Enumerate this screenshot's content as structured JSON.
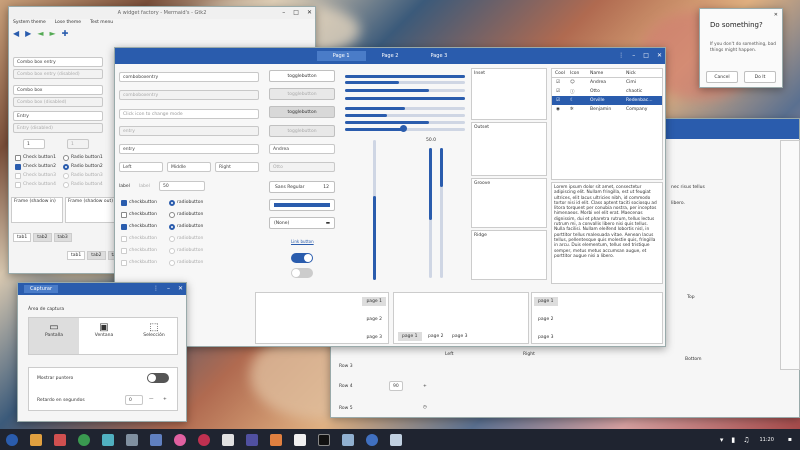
{
  "colors": {
    "accent": "#2a5cad",
    "taskbar": "#1f2430"
  },
  "main_window": {
    "title": "A widget factory - Mermaid's - Gtk2",
    "menus": [
      "System theme",
      "Lose theme",
      "Test menu"
    ]
  },
  "left_panel": {
    "combo1": "Combo box entry",
    "combo1b": "Combo box entry (disabled)",
    "combo2": "Combo box",
    "combo2b": "Combo box (disabled)",
    "entry": "Entry",
    "entry_dis": "Entry (disabled)",
    "spin1": "1",
    "spin2": "1",
    "checks": [
      "Check button1",
      "Check button2",
      "Check button3",
      "Check button4"
    ],
    "radios": [
      "Radio button1",
      "Radio button2",
      "Radio button3",
      "Radio button4"
    ],
    "frame1": "Frame (shadow in)",
    "frame2": "Frame (shadow out)",
    "tabs": [
      "tab1",
      "tab2",
      "tab3"
    ],
    "tabs2": [
      "tab1",
      "tab2",
      "tab3"
    ]
  },
  "dialog": {
    "title": "Do something?",
    "body": "If you don't do something, bad things might happen.",
    "cancel": "Cancel",
    "ok": "Do It"
  },
  "gtk3": {
    "tabs": [
      "Page 1",
      "Page 2",
      "Page 3"
    ],
    "combo": "comboboxentry",
    "combo_dis": "comboboxentry",
    "entry_click": "Click icon to change mode",
    "entry_dis": "entry",
    "entry": "entry",
    "align": [
      "Left",
      "Middle",
      "Right"
    ],
    "label": "label",
    "label2": "label",
    "spin": "50",
    "checks": [
      "checkbutton",
      "checkbutton",
      "checkbutton",
      "checkbutton",
      "checkbutton",
      "checkbutton"
    ],
    "radios": [
      "radiobutton",
      "radiobutton",
      "radiobutton",
      "radiobutton",
      "radiobutton",
      "radiobutton"
    ],
    "toggles": [
      "togglebutton",
      "togglebutton",
      "togglebutton",
      "togglebutton"
    ],
    "combo_andrea": "Andrea",
    "combo_otto": "Otto",
    "font": "Sans Regular",
    "font_size": "12",
    "none": "(None)",
    "link": "Link button",
    "scale_value": "50.0",
    "frames": [
      "Inset",
      "Outset",
      "Groove",
      "Ridge"
    ],
    "tree_headers": [
      "Cool",
      "Icon",
      "Name",
      "Nick"
    ],
    "tree_rows": [
      [
        "Andrea",
        "Cimi"
      ],
      [
        "Otto",
        "chaotic"
      ],
      [
        "Orville",
        "Redenbac..."
      ],
      [
        "Benjamin",
        "Company"
      ]
    ],
    "text": "Lorem ipsum dolor sit amet, consectetur adipiscing elit. Nullam fringilla, est ut feugiat ultrices, elit lacus ultricies nibh, id commodo tortor nisi id elit. Class aptent taciti sociosqu ad litora torquent per conubia nostra, per inceptos himenaeos. Morbi vel elit erat. Maecenas dignissim, dui et pharetra rutrum, tellus lectus rutrum mi, a convallis libero nisi quis tellus. Nulla facilisi. Nullam eleifend lobortis nisl, in porttitor tellus malesuada vitae. Aenean lacus tellus, pellentesque quis molestie quis, fringilla in arcu. Duis elementum, tellus sed tristique semper, metus metus accumsan augue, et porttitor augue nisi a libero.",
    "pages": [
      "page 1",
      "page 2",
      "page 3"
    ]
  },
  "capture": {
    "title": "Capturar",
    "area_label": "Área de captura",
    "options": [
      "Pantalla",
      "Ventana",
      "Selección"
    ],
    "pointer": "Mostrar puntero",
    "delay": "Retardo en segundos",
    "delay_value": "0"
  },
  "back_window": {
    "rows": [
      "Row 3",
      "Row 4",
      "Row 5"
    ],
    "row4_val": "90",
    "left": "Left",
    "right": "Right",
    "top": "Top",
    "bottom": "Bottom",
    "text1": "nec risus tellus",
    "text2": "libero."
  },
  "clock": "11:20"
}
